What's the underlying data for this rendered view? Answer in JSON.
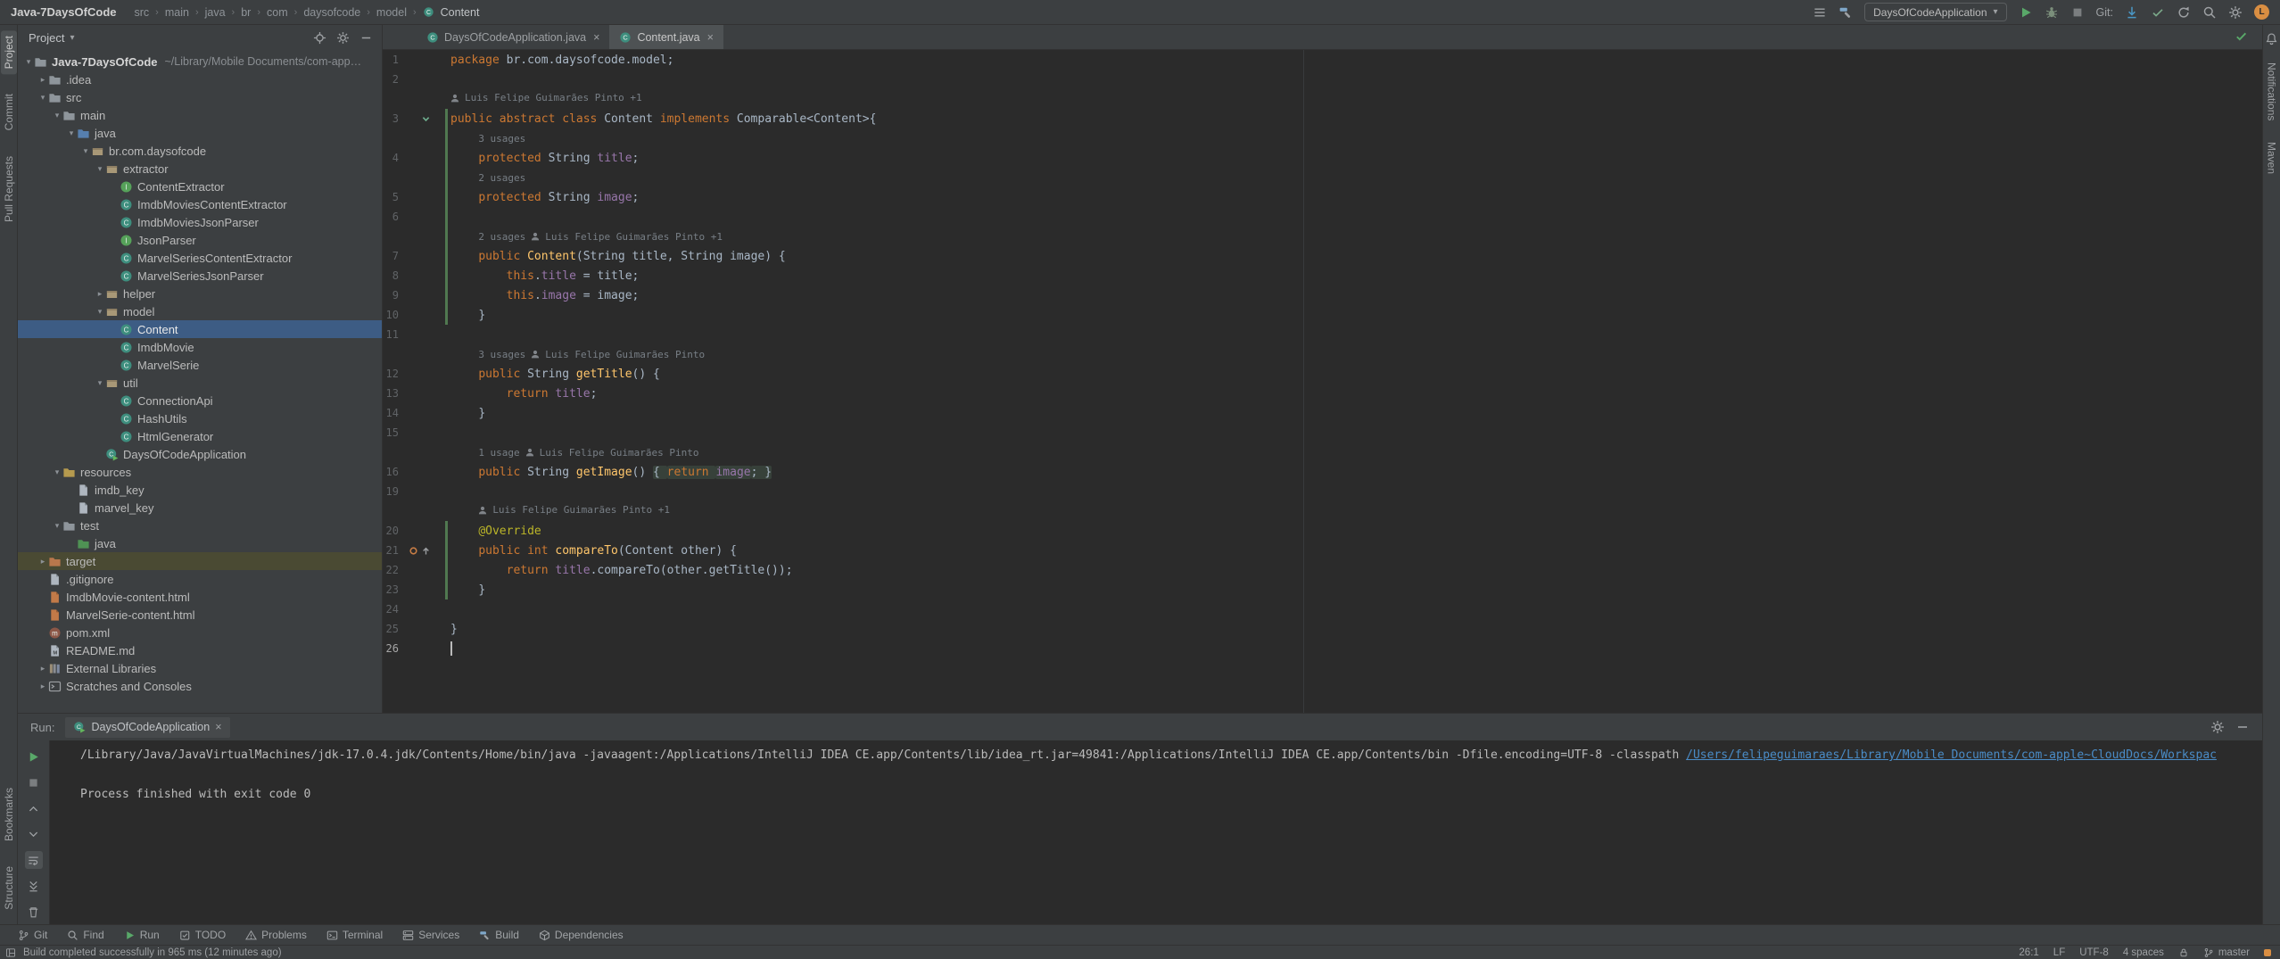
{
  "palette": {
    "chrome": "#3C3F41",
    "editor_bg": "#2B2B2B",
    "border": "#323232",
    "text": "#BBBBBB",
    "selection": "#3D5C84",
    "keyword": "#CC7832",
    "plain": "#A9B7C6",
    "field": "#9876AA",
    "method": "#FFC66B",
    "annotation": "#BBB529",
    "line_number": "#606366",
    "inlay": "#787F86",
    "link": "#4A8CC7",
    "run_green": "#59A869",
    "excluded_bg": "#4A4A33",
    "fold_bg": "#37413A",
    "guide": "#383B3D",
    "tab_active": "#4E5254",
    "vcs_added": "#507850",
    "accent_orange": "#D98E42"
  },
  "title_bar": {
    "project_name": "Java-7DaysOfCode",
    "breadcrumbs": [
      "src",
      "main",
      "java",
      "br",
      "com",
      "daysofcode",
      "model",
      "Content"
    ],
    "controls": [
      {
        "icon": "list"
      },
      {
        "icon": "hammer"
      },
      {
        "type": "runconfig",
        "label": "DaysOfCodeApplication"
      },
      {
        "icon": "play"
      },
      {
        "icon": "bug"
      },
      {
        "icon": "stop"
      },
      {
        "type": "label",
        "text": "Git:"
      },
      {
        "icon": "arrowDown"
      },
      {
        "icon": "check"
      },
      {
        "icon": "rotate"
      },
      {
        "icon": "search"
      },
      {
        "icon": "gear"
      },
      {
        "type": "avatar",
        "initial": "L"
      }
    ]
  },
  "left_strip": {
    "top": [
      {
        "label": "Project",
        "active": true
      },
      {
        "label": "Commit"
      },
      {
        "label": "Pull Requests"
      }
    ],
    "bottom": [
      {
        "label": "Bookmarks"
      },
      {
        "label": "Structure"
      }
    ]
  },
  "right_strip": {
    "top": [
      {
        "label": "Notifications"
      },
      {
        "label": "Maven"
      }
    ]
  },
  "project_panel": {
    "header": {
      "title": "Project",
      "icons": [
        "locate",
        "gear",
        "minus"
      ]
    },
    "items": [
      {
        "label": "Java-7DaysOfCode",
        "suffix": "~/Library/Mobile Documents/com-app…",
        "level": 0,
        "chev": "open",
        "icon": "folder",
        "bold": true
      },
      {
        "label": ".idea",
        "level": 1,
        "chev": "closed",
        "icon": "folder"
      },
      {
        "label": "src",
        "level": 1,
        "chev": "open",
        "icon": "folder"
      },
      {
        "label": "main",
        "level": 2,
        "chev": "open",
        "icon": "folder"
      },
      {
        "label": "java",
        "level": 3,
        "chev": "open",
        "icon": "folder_src"
      },
      {
        "label": "br.com.daysofcode",
        "level": 4,
        "chev": "open",
        "icon": "package"
      },
      {
        "label": "extractor",
        "level": 5,
        "chev": "open",
        "icon": "package"
      },
      {
        "label": "ContentExtractor",
        "level": 6,
        "icon": "interface"
      },
      {
        "label": "ImdbMoviesContentExtractor",
        "level": 6,
        "icon": "class"
      },
      {
        "label": "ImdbMoviesJsonParser",
        "level": 6,
        "icon": "class"
      },
      {
        "label": "JsonParser",
        "level": 6,
        "icon": "interface"
      },
      {
        "label": "MarvelSeriesContentExtractor",
        "level": 6,
        "icon": "class"
      },
      {
        "label": "MarvelSeriesJsonParser",
        "level": 6,
        "icon": "class"
      },
      {
        "label": "helper",
        "level": 5,
        "chev": "closed",
        "icon": "package"
      },
      {
        "label": "model",
        "level": 5,
        "chev": "open",
        "icon": "package"
      },
      {
        "label": "Content",
        "level": 6,
        "icon": "class",
        "selected": true
      },
      {
        "label": "ImdbMovie",
        "level": 6,
        "icon": "class"
      },
      {
        "label": "MarvelSerie",
        "level": 6,
        "icon": "class"
      },
      {
        "label": "util",
        "level": 5,
        "chev": "open",
        "icon": "package"
      },
      {
        "label": "ConnectionApi",
        "level": 6,
        "icon": "class"
      },
      {
        "label": "HashUtils",
        "level": 6,
        "icon": "class"
      },
      {
        "label": "HtmlGenerator",
        "level": 6,
        "icon": "class"
      },
      {
        "label": "DaysOfCodeApplication",
        "level": 5,
        "icon": "class_run"
      },
      {
        "label": "resources",
        "level": 2,
        "chev": "open",
        "icon": "folder_res"
      },
      {
        "label": "imdb_key",
        "level": 3,
        "icon": "file"
      },
      {
        "label": "marvel_key",
        "level": 3,
        "icon": "file"
      },
      {
        "label": "test",
        "level": 2,
        "chev": "open",
        "icon": "folder"
      },
      {
        "label": "java",
        "level": 3,
        "icon": "folder_test"
      },
      {
        "label": "target",
        "level": 1,
        "chev": "closed",
        "icon": "folder_x",
        "excluded": true
      },
      {
        "label": ".gitignore",
        "level": 1,
        "icon": "file"
      },
      {
        "label": "ImdbMovie-content.html",
        "level": 1,
        "icon": "html"
      },
      {
        "label": "MarvelSerie-content.html",
        "level": 1,
        "icon": "html"
      },
      {
        "label": "pom.xml",
        "level": 1,
        "icon": "maven"
      },
      {
        "label": "README.md",
        "level": 1,
        "icon": "markdown"
      },
      {
        "label": "External Libraries",
        "level": 1,
        "chev": "closed",
        "icon": "library"
      },
      {
        "label": "Scratches and Consoles",
        "level": 1,
        "chev": "closed",
        "icon": "consoles"
      }
    ]
  },
  "editor": {
    "tabs": [
      {
        "label": "DaysOfCodeApplication.java",
        "icon": "class"
      },
      {
        "label": "Content.java",
        "icon": "class",
        "active": true
      }
    ],
    "rows": [
      {
        "n": "1",
        "ind": 0,
        "t": [
          [
            "k",
            "package "
          ],
          [
            "p",
            "br.com.daysofcode.model;"
          ]
        ]
      },
      {
        "n": "2",
        "ind": 0,
        "t": []
      },
      {
        "inlay": {
          "a": "Luis Felipe Guimarães Pinto +1"
        },
        "ind": 0
      },
      {
        "n": "3",
        "ind": 0,
        "g": "impl",
        "vcs": 1,
        "t": [
          [
            "k",
            "public abstract class "
          ],
          [
            "p",
            "Content "
          ],
          [
            "k",
            "implements "
          ],
          [
            "p",
            "Comparable<Content>{"
          ]
        ]
      },
      {
        "inlay": {
          "u": "3 usages"
        },
        "ind": 4,
        "vcs": 1
      },
      {
        "n": "4",
        "ind": 4,
        "vcs": 1,
        "t": [
          [
            "k",
            "protected "
          ],
          [
            "p",
            "String "
          ],
          [
            "f",
            "title"
          ],
          [
            "p",
            ";"
          ]
        ]
      },
      {
        "inlay": {
          "u": "2 usages"
        },
        "ind": 4,
        "vcs": 1
      },
      {
        "n": "5",
        "ind": 4,
        "vcs": 1,
        "t": [
          [
            "k",
            "protected "
          ],
          [
            "p",
            "String "
          ],
          [
            "f",
            "image"
          ],
          [
            "p",
            ";"
          ]
        ]
      },
      {
        "n": "6",
        "ind": 0,
        "vcs": 1,
        "t": []
      },
      {
        "inlay": {
          "u": "2 usages",
          "a": "Luis Felipe Guimarães Pinto +1"
        },
        "ind": 4,
        "vcs": 1
      },
      {
        "n": "7",
        "ind": 4,
        "vcs": 1,
        "t": [
          [
            "k",
            "public "
          ],
          [
            "m",
            "Content"
          ],
          [
            "p",
            "(String title, String image) {"
          ]
        ]
      },
      {
        "n": "8",
        "ind": 8,
        "vcs": 1,
        "t": [
          [
            "k",
            "this"
          ],
          [
            "p",
            "."
          ],
          [
            "f",
            "title"
          ],
          [
            "p",
            " = title;"
          ]
        ]
      },
      {
        "n": "9",
        "ind": 8,
        "vcs": 1,
        "t": [
          [
            "k",
            "this"
          ],
          [
            "p",
            "."
          ],
          [
            "f",
            "image"
          ],
          [
            "p",
            " = image;"
          ]
        ]
      },
      {
        "n": "10",
        "ind": 4,
        "vcs": 1,
        "t": [
          [
            "p",
            "}"
          ]
        ]
      },
      {
        "n": "11",
        "ind": 0,
        "t": []
      },
      {
        "inlay": {
          "u": "3 usages",
          "a": "Luis Felipe Guimarães Pinto"
        },
        "ind": 4
      },
      {
        "n": "12",
        "ind": 4,
        "t": [
          [
            "k",
            "public "
          ],
          [
            "p",
            "String "
          ],
          [
            "m",
            "getTitle"
          ],
          [
            "p",
            "() {"
          ]
        ]
      },
      {
        "n": "13",
        "ind": 8,
        "t": [
          [
            "k",
            "return "
          ],
          [
            "f",
            "title"
          ],
          [
            "p",
            ";"
          ]
        ]
      },
      {
        "n": "14",
        "ind": 4,
        "t": [
          [
            "p",
            "}"
          ]
        ]
      },
      {
        "n": "15",
        "ind": 0,
        "t": []
      },
      {
        "inlay": {
          "u": "1 usage",
          "a": "Luis Felipe Guimarães Pinto"
        },
        "ind": 4
      },
      {
        "n": "16",
        "ind": 4,
        "t": [
          [
            "k",
            "public "
          ],
          [
            "p",
            "String "
          ],
          [
            "m",
            "getImage"
          ],
          [
            "p",
            "() "
          ],
          [
            "pF",
            "{ "
          ],
          [
            "kF",
            "return "
          ],
          [
            "fF",
            "image"
          ],
          [
            "pF",
            "; }"
          ]
        ]
      },
      {
        "n": "19",
        "ind": 0,
        "t": []
      },
      {
        "inlay": {
          "a": "Luis Felipe Guimarães Pinto +1"
        },
        "ind": 4
      },
      {
        "n": "20",
        "ind": 4,
        "vcs": 1,
        "t": [
          [
            "a",
            "@Override"
          ]
        ]
      },
      {
        "n": "21",
        "ind": 4,
        "vcs": 1,
        "g": "override",
        "t": [
          [
            "k",
            "public int "
          ],
          [
            "m",
            "compareTo"
          ],
          [
            "p",
            "(Content other) {"
          ]
        ]
      },
      {
        "n": "22",
        "ind": 8,
        "vcs": 1,
        "t": [
          [
            "k",
            "return "
          ],
          [
            "f",
            "title"
          ],
          [
            "p",
            ".compareTo(other.getTitle());"
          ]
        ]
      },
      {
        "n": "23",
        "ind": 4,
        "vcs": 1,
        "t": [
          [
            "p",
            "}"
          ]
        ]
      },
      {
        "n": "24",
        "ind": 0,
        "t": []
      },
      {
        "n": "25",
        "ind": 0,
        "t": [
          [
            "p",
            "}"
          ]
        ]
      },
      {
        "n": "26",
        "ind": 0,
        "caret": 1,
        "t": []
      }
    ]
  },
  "run_panel": {
    "label": "Run:",
    "tab": "DaysOfCodeApplication",
    "header_icons": [
      "gear",
      "minus"
    ],
    "tools": [
      {
        "icon": "play",
        "name": "rerun"
      },
      {
        "icon": "stop",
        "name": "stop"
      },
      {
        "icon": "up",
        "name": "previous-occurrence"
      },
      {
        "icon": "down",
        "name": "next-occurrence"
      },
      {
        "icon": "wrap",
        "name": "soft-wrap",
        "active": true
      },
      {
        "icon": "scrollEnd",
        "name": "scroll-to-end"
      },
      {
        "icon": "trash",
        "name": "clear-all"
      }
    ],
    "console": {
      "command": "/Library/Java/JavaVirtualMachines/jdk-17.0.4.jdk/Contents/Home/bin/java -javaagent:/Applications/IntelliJ IDEA CE.app/Contents/lib/idea_rt.jar=49841:/Applications/IntelliJ IDEA CE.app/Contents/bin -Dfile.encoding=UTF-8 -classpath ",
      "link": "/Users/felipeguimaraes/Library/Mobile Documents/com-apple~CloudDocs/Workspac",
      "result": "Process finished with exit code 0"
    }
  },
  "bottom_bar": {
    "items": [
      {
        "label": "Git",
        "icon": "branch"
      },
      {
        "label": "Find",
        "icon": "search"
      },
      {
        "label": "Run",
        "icon": "play"
      },
      {
        "label": "TODO",
        "icon": "todo"
      },
      {
        "label": "Problems",
        "icon": "problems"
      },
      {
        "label": "Terminal",
        "icon": "terminal"
      },
      {
        "label": "Services",
        "icon": "services"
      },
      {
        "label": "Build",
        "icon": "hammer"
      },
      {
        "label": "Dependencies",
        "icon": "deps"
      }
    ]
  },
  "status_bar": {
    "left": "Build completed successfully in 965 ms (12 minutes ago)",
    "right": [
      {
        "text": "26:1"
      },
      {
        "text": "LF"
      },
      {
        "text": "UTF-8"
      },
      {
        "text": "4 spaces"
      },
      {
        "icon": "lock"
      },
      {
        "icon": "branch",
        "text": "master"
      }
    ]
  }
}
